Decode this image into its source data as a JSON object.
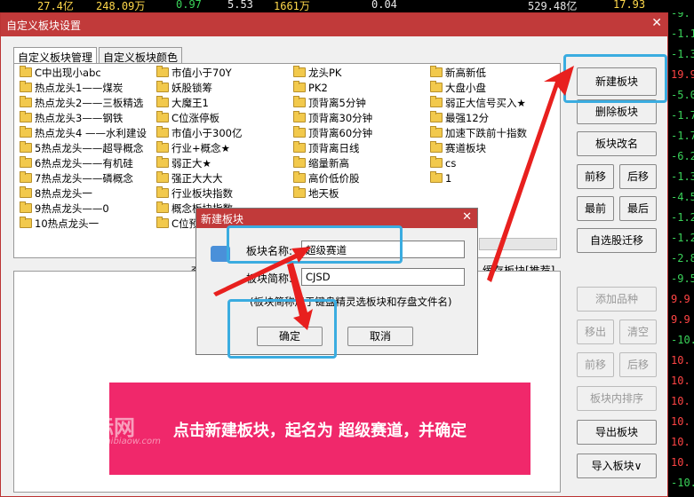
{
  "ticker": [
    "27.4亿",
    "248.09万",
    "0.97",
    "5.53",
    "1661万",
    "0.04",
    "529.48亿",
    "17.93"
  ],
  "right_values": [
    "-9.",
    "-1.1",
    "-1.3",
    "19.9",
    "-5.0",
    "-1.7",
    "-1.7",
    "-6.2",
    "-1.3",
    "-4.5",
    "-1.2",
    "-1.2",
    "-2.8",
    "-9.5",
    "9.9",
    "9.9",
    "-10.",
    "10.",
    "10.",
    "10.",
    "10.",
    "10.",
    "10.",
    "-10."
  ],
  "window": {
    "title": "自定义板块设置",
    "close": "✕"
  },
  "tabs": [
    "自定义板块管理",
    "自定义板块颜色"
  ],
  "boards": {
    "col1": [
      "C中出现小abc",
      "热点龙头1——煤炭",
      "热点龙头2——三板精选",
      "热点龙头3——钢铁",
      "热点龙头4 ——水利建设",
      "5热点龙头——超导概念",
      "6热点龙头——有机硅",
      "7热点龙头——磷概念",
      "8热点龙头一",
      "9热点龙头——0",
      "10热点龙头一"
    ],
    "col2": [
      "市值小于70Y",
      "妖股锁筹",
      "大魔王1",
      "C位涨停板",
      "市值小于300亿",
      "行业+概念★",
      "弱正大★",
      "强正大大大",
      "行业板块指数",
      "概念板块指数",
      "C位预"
    ],
    "col3": [
      "龙头PK",
      "PK2",
      "顶背离5分钟",
      "顶背离30分钟",
      "顶背离60分钟",
      "顶背离日线",
      "缩量新高",
      "高价低价股",
      "地天板"
    ],
    "col4": [
      "新高新低",
      "大盘小盘",
      "弱正大信号买入★",
      "最强12分",
      "加速下跌前十指数",
      "赛道板块",
      "cs",
      "1"
    ]
  },
  "buttons_right": {
    "new_board": "新建板块",
    "delete_board": "删除板块",
    "rename_board": "板块改名",
    "move_front": "前移",
    "move_back": "后移",
    "to_first": "最前",
    "to_last": "最后",
    "migrate": "自选股迁移",
    "add_item": "添加品种",
    "remove": "移出",
    "clear": "清空",
    "item_front": "前移",
    "item_back": "后移",
    "sort": "板块内排序",
    "export": "导出板块",
    "import": "导入板块∨"
  },
  "mid_labels": {
    "left_fragment": "查",
    "cache": "缓存板块[推荐]"
  },
  "dialog": {
    "title": "新建板块",
    "close": "✕",
    "name_label": "板块名称:",
    "name_value": "超级赛道",
    "short_label": "板块简称:",
    "short_value": "CJSD",
    "hint": "(板块简称用于键盘精灵选板块和存盘文件名)",
    "ok": "确定",
    "cancel": "取消"
  },
  "banner": {
    "text": "点击新建板块，起名为 超级赛道，并确定",
    "watermark": "盾标网",
    "watermark_url": "www.zhibiaow.com"
  }
}
